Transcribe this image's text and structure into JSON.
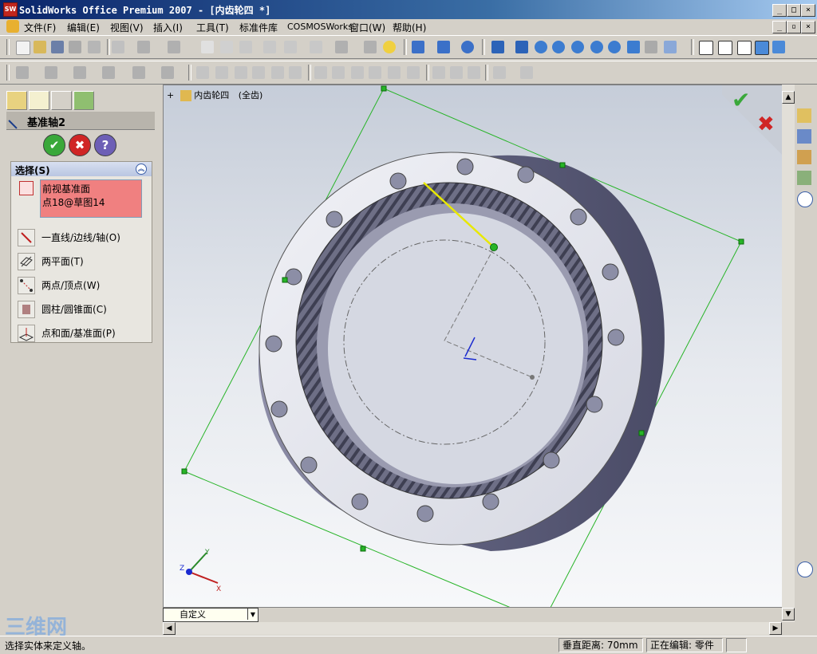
{
  "window": {
    "title": "SolidWorks Office Premium 2007 - [内齿轮四 *]",
    "logo_text": "SW"
  },
  "menu": [
    "文件(F)",
    "编辑(E)",
    "视图(V)",
    "插入(I)",
    "工具(T)",
    "标准件库",
    "COSMOSWorks",
    "窗口(W)",
    "帮助(H)"
  ],
  "property_manager": {
    "title": "基准轴2",
    "ok_symbol": "✔",
    "cancel_symbol": "✖",
    "help_symbol": "?",
    "section_title": "选择(S)",
    "selections": [
      "前视基准面",
      "点18@草图14"
    ],
    "options": [
      "一直线/边线/轴(O)",
      "两平面(T)",
      "两点/顶点(W)",
      "圆柱/圆锥面(C)",
      "点和面/基准面(P)"
    ]
  },
  "feature_tree": {
    "root_label": "内齿轮四",
    "config_label": "(全齿)"
  },
  "view": {
    "orientation_dropdown": "自定义",
    "triad_labels": [
      "X",
      "Y",
      "Z"
    ]
  },
  "watermark": "三维网",
  "status": {
    "message": "选择实体来定义轴。",
    "distance": "垂直距离: 70mm",
    "editing": "正在编辑: 零件"
  },
  "colors": {
    "accept": "#3aa83a",
    "reject": "#d02525",
    "selection_box": "#f08080",
    "plane": "#27b427",
    "axis_preview": "#e8e800",
    "gear_body": "#e6e8ef"
  }
}
